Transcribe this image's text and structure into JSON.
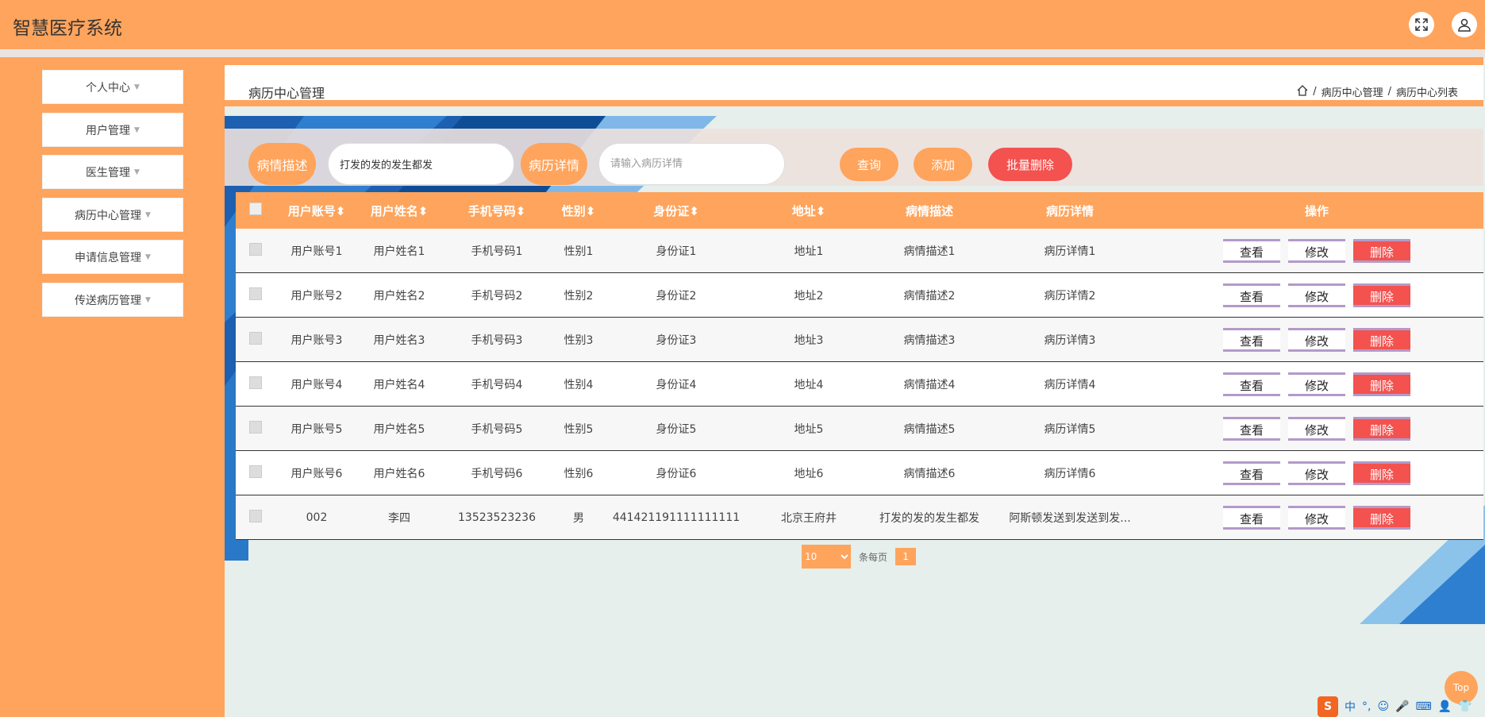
{
  "app_title": "智慧医疗系统",
  "header_icons": [
    "fullscreen-icon",
    "user-icon"
  ],
  "sidebar": {
    "items": [
      {
        "label": "个人中心"
      },
      {
        "label": "用户管理"
      },
      {
        "label": "医生管理"
      },
      {
        "label": "病历中心管理"
      },
      {
        "label": "申请信息管理"
      },
      {
        "label": "传送病历管理"
      }
    ]
  },
  "page": {
    "title": "病历中心管理",
    "breadcrumb": [
      "病历中心管理",
      "病历中心列表"
    ]
  },
  "search": {
    "label1": "病情描述",
    "value1": "打发的发的发生都发",
    "label2": "病历详情",
    "placeholder2": "请输入病历详情",
    "query_label": "查询",
    "add_label": "添加",
    "batch_delete_label": "批量删除"
  },
  "table": {
    "columns": [
      "用户账号",
      "用户姓名",
      "手机号码",
      "性别",
      "身份证",
      "地址",
      "病情描述",
      "病历详情",
      "操作"
    ],
    "rows": [
      [
        "用户账号1",
        "用户姓名1",
        "手机号码1",
        "性别1",
        "身份证1",
        "地址1",
        "病情描述1",
        "病历详情1"
      ],
      [
        "用户账号2",
        "用户姓名2",
        "手机号码2",
        "性别2",
        "身份证2",
        "地址2",
        "病情描述2",
        "病历详情2"
      ],
      [
        "用户账号3",
        "用户姓名3",
        "手机号码3",
        "性别3",
        "身份证3",
        "地址3",
        "病情描述3",
        "病历详情3"
      ],
      [
        "用户账号4",
        "用户姓名4",
        "手机号码4",
        "性别4",
        "身份证4",
        "地址4",
        "病情描述4",
        "病历详情4"
      ],
      [
        "用户账号5",
        "用户姓名5",
        "手机号码5",
        "性别5",
        "身份证5",
        "地址5",
        "病情描述5",
        "病历详情5"
      ],
      [
        "用户账号6",
        "用户姓名6",
        "手机号码6",
        "性别6",
        "身份证6",
        "地址6",
        "病情描述6",
        "病历详情6"
      ],
      [
        "002",
        "李四",
        "13523523236",
        "男",
        "441421191111111111",
        "北京王府井",
        "打发的发的发生都发",
        "阿斯顿发送到发送到发..."
      ]
    ],
    "actions": {
      "view": "查看",
      "edit": "修改",
      "delete": "删除"
    }
  },
  "pagination": {
    "page_size": "10",
    "per_page_label": "条每页",
    "current_page": "1"
  },
  "top_button": "Top",
  "ime_bar": {
    "logo": "S",
    "mode": "中",
    "punct": "°,"
  },
  "colors": {
    "primary": "#ffa45c",
    "danger": "#f3524f",
    "background": "#e6efeb"
  }
}
